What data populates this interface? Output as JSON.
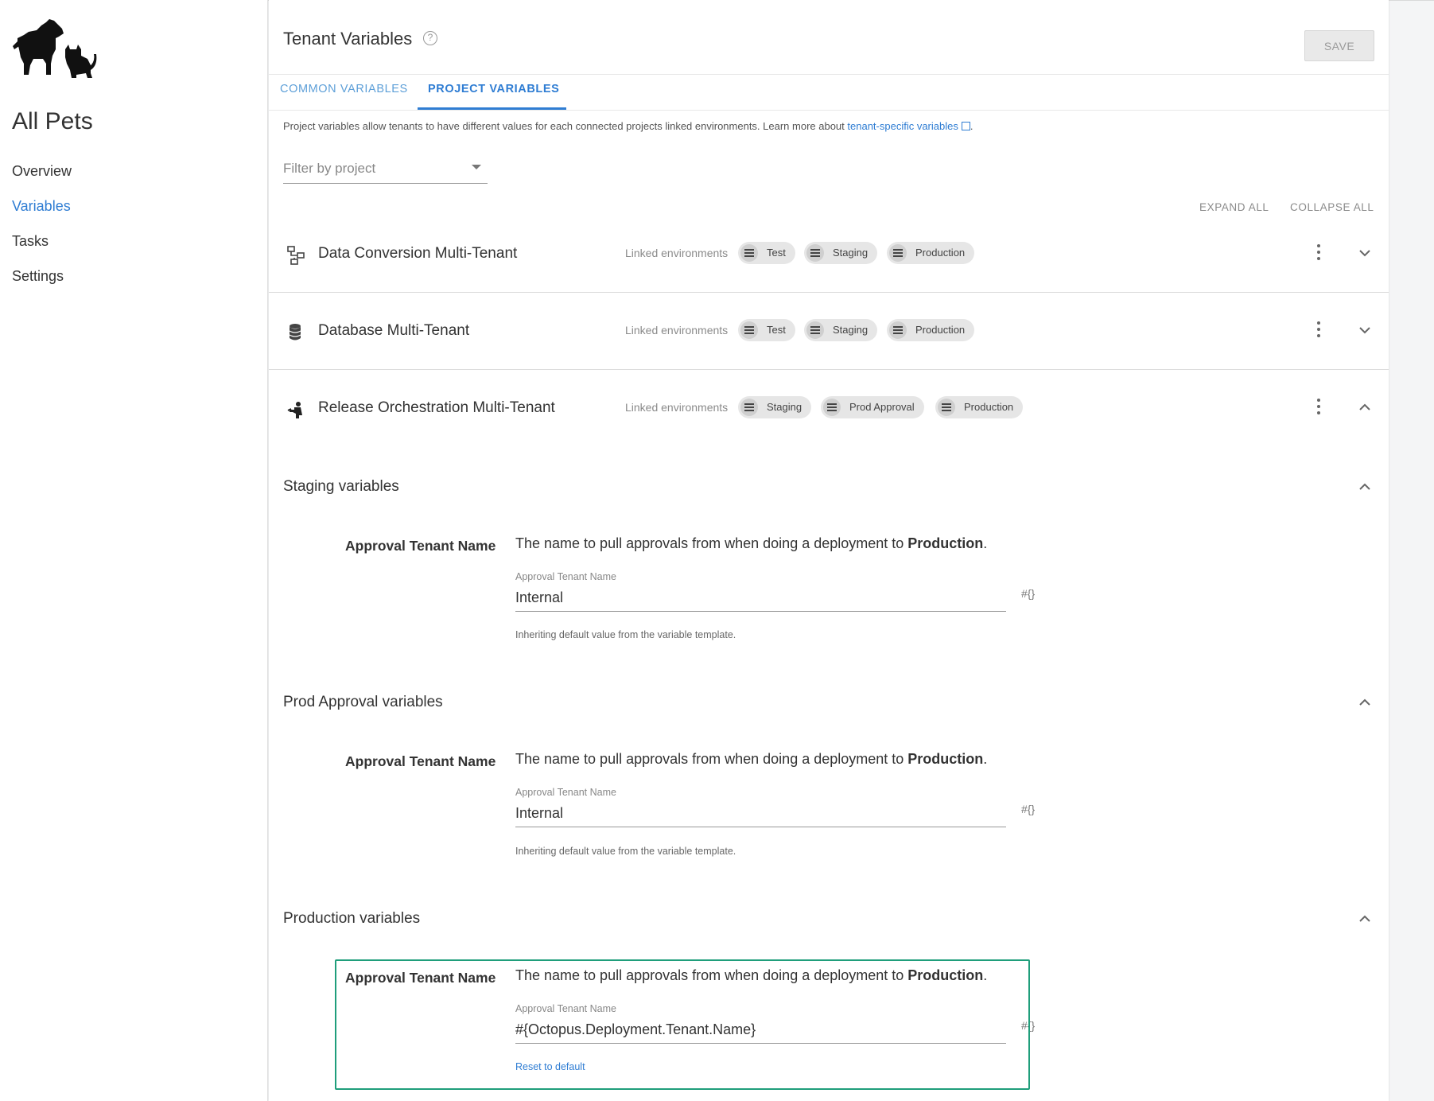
{
  "sidebar": {
    "tenant_name": "All Pets",
    "nav": [
      {
        "label": "Overview"
      },
      {
        "label": "Variables"
      },
      {
        "label": "Tasks"
      },
      {
        "label": "Settings"
      }
    ]
  },
  "header": {
    "title": "Tenant Variables",
    "help_symbol": "?",
    "save_label": "SAVE"
  },
  "tabs": [
    {
      "label": "COMMON VARIABLES"
    },
    {
      "label": "PROJECT VARIABLES"
    }
  ],
  "description": {
    "text": "Project variables allow tenants to have different values for each connected projects linked environments. Learn more about ",
    "link": "tenant-specific variables",
    "suffix": "."
  },
  "filter": {
    "placeholder": "Filter by project"
  },
  "actions": {
    "expand_all": "EXPAND ALL",
    "collapse_all": "COLLAPSE ALL"
  },
  "projects": [
    {
      "name": "Data Conversion Multi-Tenant",
      "linked_label": "Linked environments",
      "environments": [
        "Test",
        "Staging",
        "Production"
      ],
      "icon": "process-icon",
      "expanded": false
    },
    {
      "name": "Database Multi-Tenant",
      "linked_label": "Linked environments",
      "environments": [
        "Test",
        "Staging",
        "Production"
      ],
      "icon": "database-icon",
      "expanded": false
    },
    {
      "name": "Release Orchestration Multi-Tenant",
      "linked_label": "Linked environments",
      "environments": [
        "Staging",
        "Prod Approval",
        "Production"
      ],
      "icon": "orchestration-icon",
      "expanded": true
    }
  ],
  "sections": [
    {
      "title": "Staging variables",
      "var_label": "Approval Tenant Name",
      "var_desc": "The name to pull approvals from when doing a deployment to ",
      "var_desc_bold": "Production",
      "var_desc_end": ".",
      "field_label": "Approval Tenant Name",
      "value": "Internal",
      "hash": "#{}",
      "hint": "Inheriting default value from the variable template."
    },
    {
      "title": "Prod Approval variables",
      "var_label": "Approval Tenant Name",
      "var_desc": "The name to pull approvals from when doing a deployment to ",
      "var_desc_bold": "Production",
      "var_desc_end": ".",
      "field_label": "Approval Tenant Name",
      "value": "Internal",
      "hash": "#{}",
      "hint": "Inheriting default value from the variable template."
    },
    {
      "title": "Production variables",
      "var_label": "Approval Tenant Name",
      "var_desc": "The name to pull approvals from when doing a deployment to ",
      "var_desc_bold": "Production",
      "var_desc_end": ".",
      "field_label": "Approval Tenant Name",
      "value": "#{Octopus.Deployment.Tenant.Name}",
      "hash": "#{}",
      "reset": "Reset to default"
    }
  ],
  "colors": {
    "accent": "#2f7dd3",
    "highlight": "#1f9e7b"
  }
}
